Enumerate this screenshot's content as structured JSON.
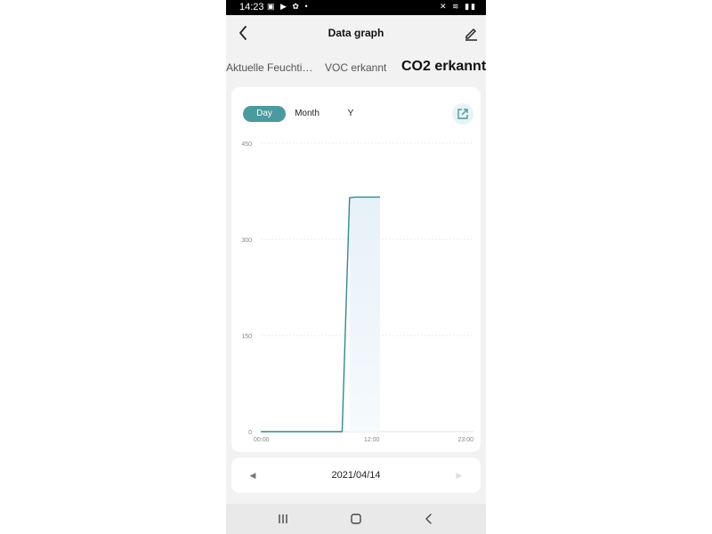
{
  "status_bar": {
    "time": "14:23",
    "left_icons": "▣ ▶ ✿ •",
    "right_icons": "✕ ≋ ▮▮"
  },
  "header": {
    "title": "Data graph",
    "back_icon": "chevron-left-icon",
    "edit_icon": "pencil-icon"
  },
  "tabs": [
    {
      "label": "Aktuelle Feuchtigkeit",
      "active": false
    },
    {
      "label": "VOC erkannt",
      "active": false
    },
    {
      "label": "CO2 erkannt",
      "active": true
    }
  ],
  "range_tabs": [
    {
      "label": "Day",
      "active": true
    },
    {
      "label": "Month",
      "active": false
    },
    {
      "label": "Y",
      "active": false
    }
  ],
  "colors": {
    "accent": "#4a9a9e",
    "line": "#2f8a8f",
    "area_top": "#e6f1f8",
    "area_bottom": "#f6fafd",
    "grid": "#e3e3e3"
  },
  "chart_data": {
    "type": "area",
    "y_ticks": [
      "450",
      "300",
      "150",
      "0"
    ],
    "x_ticks": [
      "00:00",
      "12:00",
      "23:00"
    ],
    "ylim": [
      0,
      450
    ],
    "xlim": [
      0,
      23
    ],
    "grid": true,
    "points": [
      {
        "x": 0,
        "y": 0
      },
      {
        "x": 8.8,
        "y": 0
      },
      {
        "x": 9.6,
        "y": 365
      },
      {
        "x": 10.2,
        "y": 366
      },
      {
        "x": 12.9,
        "y": 366
      }
    ]
  },
  "date_nav": {
    "date": "2021/04/14",
    "prev": "◀",
    "next": "▶"
  }
}
